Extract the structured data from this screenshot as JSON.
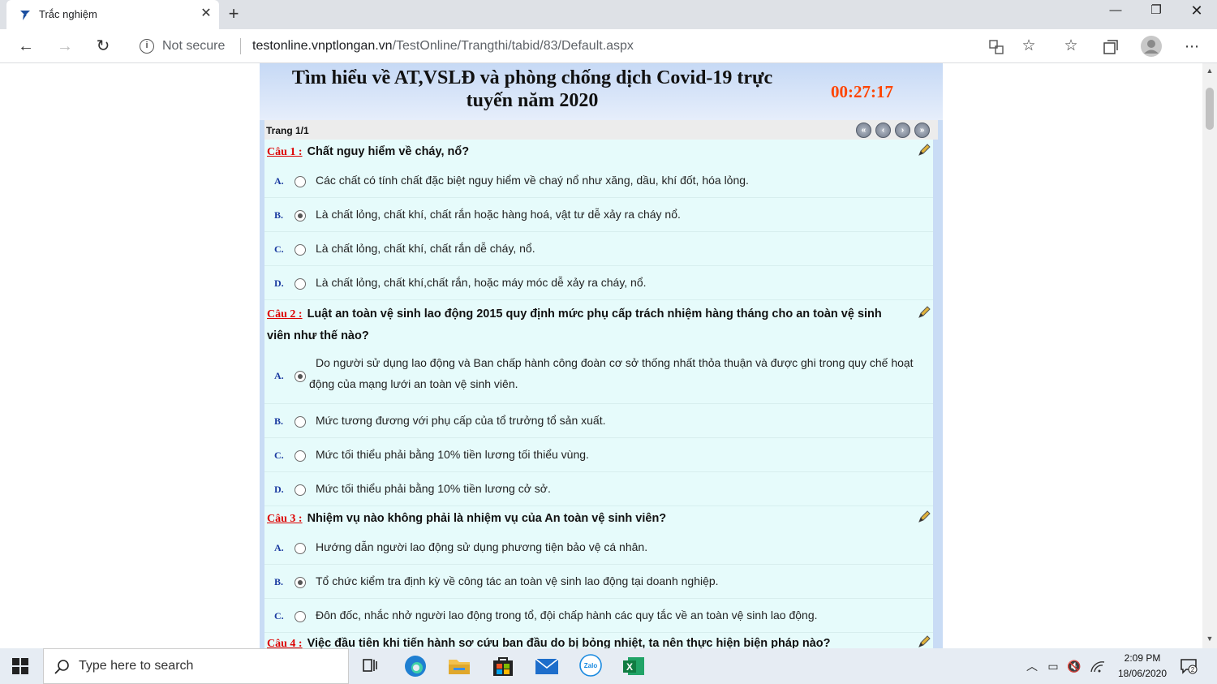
{
  "browser": {
    "tab_title": "Trắc nghiệm",
    "new_tab": "+",
    "not_secure": "Not secure",
    "url_host": "testonline.vnptlongan.vn",
    "url_path": "/TestOnline/Trangthi/tabid/83/Default.aspx"
  },
  "exam": {
    "title_line1": "Tìm hiểu về AT,VSLĐ và phòng chống dịch Covid-19 trực",
    "title_line2": "tuyến năm 2020",
    "timer": "00:27:17",
    "page_label": "Trang 1/1"
  },
  "questions": [
    {
      "number": "Câu 1 :",
      "text": "Chất nguy hiểm về cháy, nổ?",
      "options": [
        {
          "letter": "A.",
          "text": "Các chất có tính chất đặc biệt nguy hiểm về chaý nổ như xăng, dầu, khí đốt, hóa lỏng.",
          "checked": false
        },
        {
          "letter": "B.",
          "text": "Là chất lỏng, chất khí, chất rắn hoặc hàng hoá, vật tư dễ xảy ra cháy nổ.",
          "checked": true
        },
        {
          "letter": "C.",
          "text": "Là chất lỏng, chất khí, chất rắn dễ cháy, nổ.",
          "checked": false
        },
        {
          "letter": "D.",
          "text": "Là chất lỏng, chất khí,chất rắn, hoặc máy móc dễ xảy ra cháy, nổ.",
          "checked": false
        }
      ]
    },
    {
      "number": "Câu 2 :",
      "text": "Luật an toàn vệ sinh lao động 2015 quy định mức phụ cấp trách nhiệm hàng tháng cho an toàn vệ sinh viên như thế nào?",
      "options": [
        {
          "letter": "A.",
          "text": "Do người sử dụng lao động và Ban chấp hành công đoàn cơ sở thống nhất thỏa thuận và được ghi trong quy chế hoạt động của mạng lưới an toàn vệ sinh viên.",
          "checked": true
        },
        {
          "letter": "B.",
          "text": "Mức tương đương với phụ cấp của tổ trưởng tổ sản xuất.",
          "checked": false
        },
        {
          "letter": "C.",
          "text": "Mức tối thiểu phải bằng 10% tiền lương tối thiểu vùng.",
          "checked": false
        },
        {
          "letter": "D.",
          "text": "Mức tối thiểu phải bằng 10% tiền lương cở sở.",
          "checked": false
        }
      ]
    },
    {
      "number": "Câu 3 :",
      "text": "Nhiệm vụ nào không phải là nhiệm vụ của An toàn vệ sinh viên?",
      "options": [
        {
          "letter": "A.",
          "text": "Hướng dẫn người lao động sử dụng phương tiện bảo vệ cá nhân.",
          "checked": false
        },
        {
          "letter": "B.",
          "text": "Tổ chức kiểm tra định kỳ về công tác an toàn vệ sinh lao động tại doanh nghiệp.",
          "checked": true
        },
        {
          "letter": "C.",
          "text": "Đôn đốc, nhắc nhở người lao động trong tổ, đội chấp hành các quy tắc về an toàn vệ sinh lao động.",
          "checked": false
        }
      ]
    },
    {
      "number": "Câu 4 :",
      "text": "Việc đầu tiên khi tiến hành sơ cứu ban đầu do bị bỏng nhiệt, ta nên thực hiện biện pháp nào?",
      "options": []
    }
  ],
  "taskbar": {
    "search_placeholder": "Type here to search",
    "time": "2:09 PM",
    "date": "18/06/2020",
    "notif_count": "2"
  },
  "colors": {
    "accent_timer": "#ff4500",
    "question_number": "#dd0000",
    "question_bg": "#e6fbfb"
  }
}
